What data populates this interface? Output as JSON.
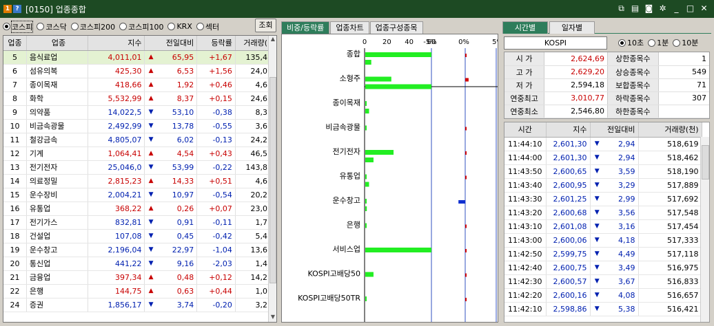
{
  "window": {
    "badge1": "1",
    "badge2": "?",
    "title": "[0150] 업종종합"
  },
  "markets": [
    {
      "label": "코스피",
      "selected": true
    },
    {
      "label": "코스닥",
      "selected": false
    },
    {
      "label": "코스피200",
      "selected": false
    },
    {
      "label": "코스피100",
      "selected": false
    },
    {
      "label": "KRX",
      "selected": false
    },
    {
      "label": "섹터",
      "selected": false
    }
  ],
  "search_label": "조회",
  "sector_table": {
    "headers": [
      "업종",
      "업종",
      "지수",
      "전일대비",
      "등락률",
      "거래량("
    ],
    "rows": [
      {
        "code": "5",
        "name": "음식료업",
        "index": "4,011,01",
        "dir": "up",
        "change": "65,95",
        "rate": "+1,67",
        "volume": "135,4"
      },
      {
        "code": "6",
        "name": "섬유의복",
        "index": "425,30",
        "dir": "up",
        "change": "6,53",
        "rate": "+1,56",
        "volume": "24,0"
      },
      {
        "code": "7",
        "name": "종이목재",
        "index": "418,66",
        "dir": "up",
        "change": "1,92",
        "rate": "+0,46",
        "volume": "4,6"
      },
      {
        "code": "8",
        "name": "화학",
        "index": "5,532,99",
        "dir": "up",
        "change": "8,37",
        "rate": "+0,15",
        "volume": "24,6"
      },
      {
        "code": "9",
        "name": "의약품",
        "index": "14,022,5",
        "dir": "dn",
        "change": "53,10",
        "rate": "-0,38",
        "volume": "8,3"
      },
      {
        "code": "10",
        "name": "비금속광물",
        "index": "2,492,99",
        "dir": "dn",
        "change": "13,78",
        "rate": "-0,55",
        "volume": "3,6"
      },
      {
        "code": "11",
        "name": "철강금속",
        "index": "4,805,07",
        "dir": "dn",
        "change": "6,02",
        "rate": "-0,13",
        "volume": "24,2"
      },
      {
        "code": "12",
        "name": "기계",
        "index": "1,064,41",
        "dir": "up",
        "change": "4,54",
        "rate": "+0,43",
        "volume": "46,5"
      },
      {
        "code": "13",
        "name": "전기전자",
        "index": "25,046,0",
        "dir": "dn",
        "change": "53,99",
        "rate": "-0,22",
        "volume": "143,8"
      },
      {
        "code": "14",
        "name": "의료정밀",
        "index": "2,815,23",
        "dir": "up",
        "change": "14,33",
        "rate": "+0,51",
        "volume": "4,6"
      },
      {
        "code": "15",
        "name": "운수장비",
        "index": "2,004,21",
        "dir": "dn",
        "change": "10,97",
        "rate": "-0,54",
        "volume": "20,2"
      },
      {
        "code": "16",
        "name": "유통업",
        "index": "368,22",
        "dir": "up",
        "change": "0,26",
        "rate": "+0,07",
        "volume": "23,0"
      },
      {
        "code": "17",
        "name": "전기가스",
        "index": "832,81",
        "dir": "dn",
        "change": "0,91",
        "rate": "-0,11",
        "volume": "1,7"
      },
      {
        "code": "18",
        "name": "건설업",
        "index": "107,08",
        "dir": "dn",
        "change": "0,45",
        "rate": "-0,42",
        "volume": "5,4"
      },
      {
        "code": "19",
        "name": "운수창고",
        "index": "2,196,04",
        "dir": "dn",
        "change": "22,97",
        "rate": "-1,04",
        "volume": "13,6"
      },
      {
        "code": "20",
        "name": "통신업",
        "index": "441,22",
        "dir": "dn",
        "change": "9,16",
        "rate": "-2,03",
        "volume": "1,4"
      },
      {
        "code": "21",
        "name": "금융업",
        "index": "397,34",
        "dir": "up",
        "change": "0,48",
        "rate": "+0,12",
        "volume": "14,2"
      },
      {
        "code": "22",
        "name": "은행",
        "index": "144,75",
        "dir": "up",
        "change": "0,63",
        "rate": "+0,44",
        "volume": "1,0"
      },
      {
        "code": "24",
        "name": "증권",
        "index": "1,856,17",
        "dir": "dn",
        "change": "3,74",
        "rate": "-0,20",
        "volume": "3,2"
      }
    ]
  },
  "mid_tabs": [
    "비중/등락률",
    "업종차트",
    "업종구성종목"
  ],
  "chart_data": {
    "type": "bar",
    "categories": [
      "종합",
      "소형주",
      "종이목재",
      "비금속광물",
      "전기전자",
      "유통업",
      "운수창고",
      "은행",
      "서비스업",
      "KOSPI고배당50",
      "KOSPI고배당50TR"
    ],
    "weight_axis": {
      "ticks": [
        "0",
        "20",
        "40",
        "60"
      ],
      "range": [
        0,
        60
      ]
    },
    "rate_axis": {
      "ticks": [
        "-5%",
        "0%",
        "5%"
      ],
      "range": [
        -5,
        5
      ]
    },
    "series": [
      {
        "values_weight": [
          60,
          24,
          0.5,
          0.5,
          26,
          0.5,
          0.5,
          0.5,
          60,
          8,
          0.2
        ],
        "values_weight2": [
          6,
          60,
          4,
          0,
          8,
          4,
          2,
          0,
          0,
          0,
          0
        ]
      },
      {
        "values_rate": [
          0.1,
          0.5,
          0,
          0.1,
          0.1,
          0.1,
          -1.0,
          0.1,
          0.1,
          0.1,
          0.1
        ]
      }
    ],
    "colors": {
      "weight": "#22ee22",
      "up": "#d00000",
      "down": "#1030d0"
    }
  },
  "right_tabs": [
    "시간별",
    "일자별"
  ],
  "index_name": "KOSPI",
  "intervals": [
    {
      "label": "10초",
      "selected": true
    },
    {
      "label": "1분",
      "selected": false
    },
    {
      "label": "10분",
      "selected": false
    }
  ],
  "stats": [
    {
      "label": "시 가",
      "value": "2,624,69",
      "cls": "up",
      "label2": "상한종목수",
      "value2": ""
    },
    {
      "label": "고 가",
      "value": "2,629,20",
      "cls": "up",
      "label2": "상승종목수",
      "value2": "549"
    },
    {
      "label": "저 가",
      "value": "2,594,18",
      "cls": "",
      "label2": "보합종목수",
      "value2": "71"
    },
    {
      "label": "연중최고",
      "value": "3,010,77",
      "cls": "up",
      "label2": "하락종목수",
      "value2": "307"
    },
    {
      "label": "연중최소",
      "value": "2,546,80",
      "cls": "",
      "label2": "하한종목수",
      "value2": ""
    }
  ],
  "stats_first_value2": "1",
  "tick_table": {
    "headers": [
      "시간",
      "지수",
      "전일대비",
      "거래량(천)"
    ],
    "rows": [
      {
        "time": "11:44:10",
        "index": "2,601,30",
        "change": "2,94",
        "volume": "518,619"
      },
      {
        "time": "11:44:00",
        "index": "2,601,30",
        "change": "2,94",
        "volume": "518,462"
      },
      {
        "time": "11:43:50",
        "index": "2,600,65",
        "change": "3,59",
        "volume": "518,190"
      },
      {
        "time": "11:43:40",
        "index": "2,600,95",
        "change": "3,29",
        "volume": "517,889"
      },
      {
        "time": "11:43:30",
        "index": "2,601,25",
        "change": "2,99",
        "volume": "517,692"
      },
      {
        "time": "11:43:20",
        "index": "2,600,68",
        "change": "3,56",
        "volume": "517,548"
      },
      {
        "time": "11:43:10",
        "index": "2,601,08",
        "change": "3,16",
        "volume": "517,454"
      },
      {
        "time": "11:43:00",
        "index": "2,600,06",
        "change": "4,18",
        "volume": "517,333"
      },
      {
        "time": "11:42:50",
        "index": "2,599,75",
        "change": "4,49",
        "volume": "517,118"
      },
      {
        "time": "11:42:40",
        "index": "2,600,75",
        "change": "3,49",
        "volume": "516,975"
      },
      {
        "time": "11:42:30",
        "index": "2,600,57",
        "change": "3,67",
        "volume": "516,833"
      },
      {
        "time": "11:42:20",
        "index": "2,600,16",
        "change": "4,08",
        "volume": "516,657"
      },
      {
        "time": "11:42:10",
        "index": "2,598,86",
        "change": "5,38",
        "volume": "516,421"
      }
    ]
  }
}
